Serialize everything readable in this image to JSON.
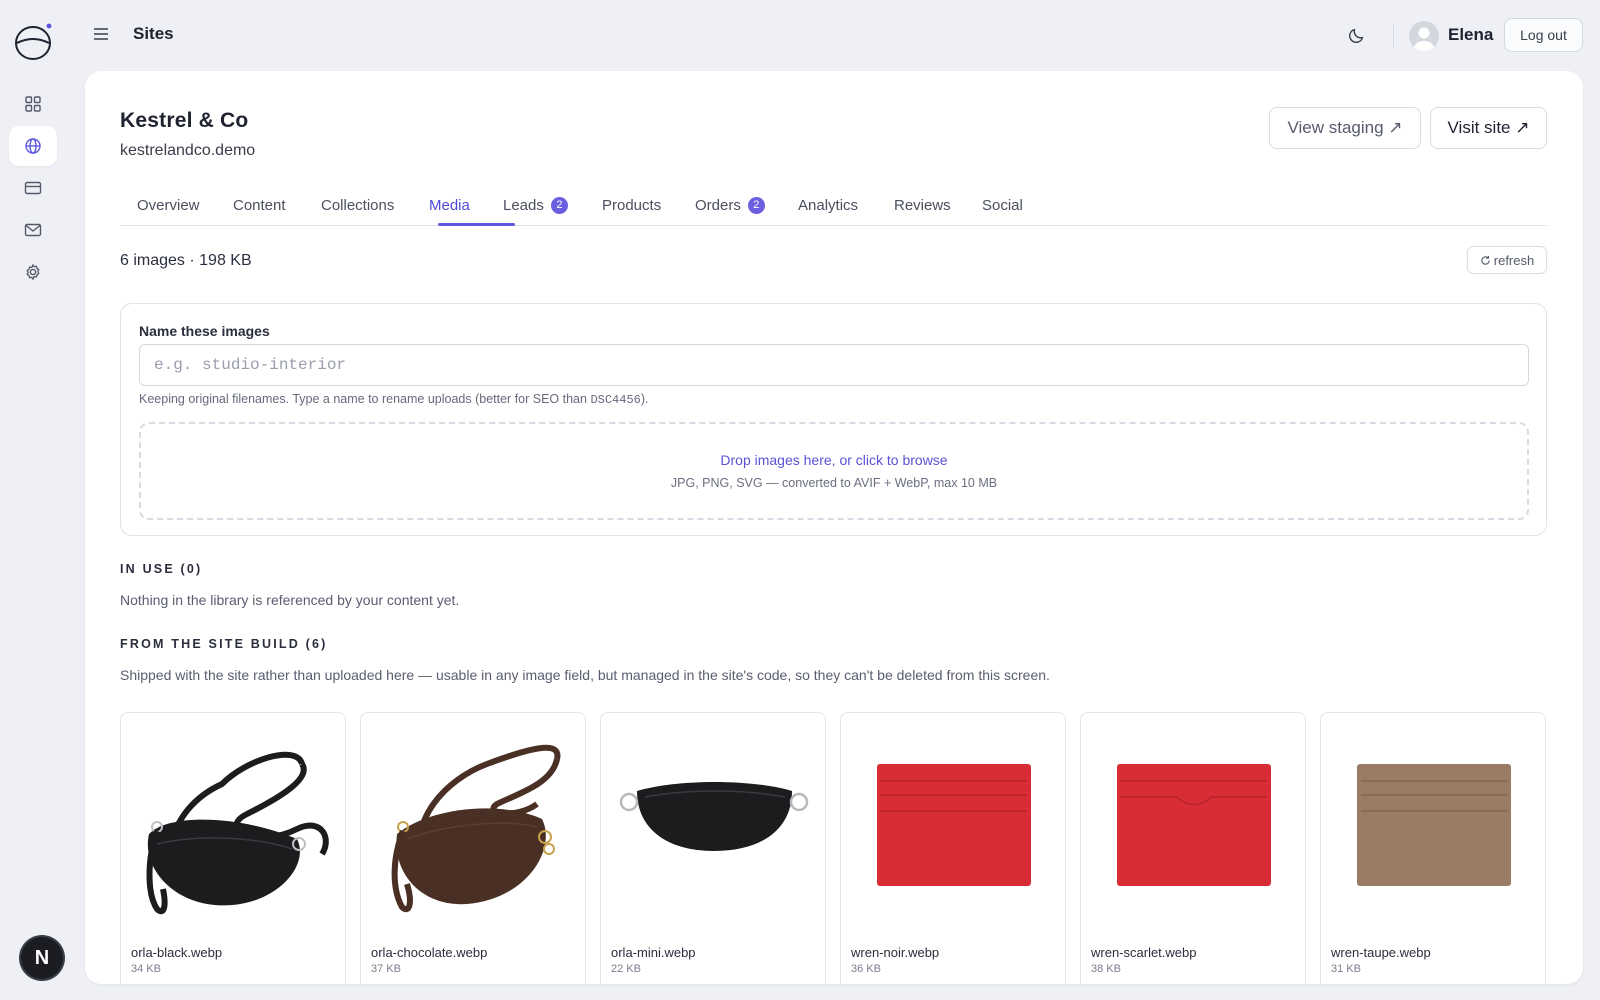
{
  "topbar": {
    "title": "Sites",
    "username": "Elena",
    "logout_label": "Log out"
  },
  "site": {
    "name": "Kestrel & Co",
    "domain": "kestrelandco.demo",
    "view_staging_label": "View staging ↗",
    "visit_site_label": "Visit site ↗"
  },
  "tabs": [
    {
      "label": "Overview"
    },
    {
      "label": "Content"
    },
    {
      "label": "Collections"
    },
    {
      "label": "Media",
      "active": true
    },
    {
      "label": "Leads",
      "badge": "2"
    },
    {
      "label": "Products"
    },
    {
      "label": "Orders",
      "badge": "2"
    },
    {
      "label": "Analytics"
    },
    {
      "label": "Reviews"
    },
    {
      "label": "Social"
    }
  ],
  "media": {
    "stats": "6 images · 198 KB",
    "refresh_label": "refresh",
    "upload": {
      "label": "Name these images",
      "placeholder": "e.g. studio-interior",
      "help_prefix": "Keeping original filenames. Type a name to rename uploads (better for SEO than ",
      "help_code": "DSC4456",
      "help_suffix": ").",
      "drop_main": "Drop images here, or click to browse",
      "drop_sub": "JPG, PNG, SVG — converted to AVIF + WebP, max 10 MB"
    },
    "in_use": {
      "title": "In use (0)",
      "text": "Nothing in the library is referenced by your content yet."
    },
    "site_build": {
      "title": "From the site build (6)",
      "text": "Shipped with the site rather than uploaded here — usable in any image field, but managed in the site's code, so they can't be deleted from this screen."
    },
    "images": [
      {
        "name": "orla-black.webp",
        "size": "34 KB",
        "kind": "bag",
        "color": "#1c1c1e"
      },
      {
        "name": "orla-chocolate.webp",
        "size": "37 KB",
        "kind": "bag",
        "color": "#4a2f24"
      },
      {
        "name": "orla-mini.webp",
        "size": "22 KB",
        "kind": "mini",
        "color": "#1c1c1e"
      },
      {
        "name": "wren-noir.webp",
        "size": "36 KB",
        "kind": "card",
        "color": "#d92d35"
      },
      {
        "name": "wren-scarlet.webp",
        "size": "38 KB",
        "kind": "card",
        "color": "#d92d35"
      },
      {
        "name": "wren-taupe.webp",
        "size": "31 KB",
        "kind": "card",
        "color": "#9c7b66"
      }
    ]
  },
  "colors": {
    "accent": "#5e5be0",
    "badge": "#6b5fe0",
    "brand_dot": "#5b53e0"
  },
  "rail_badge": "N"
}
